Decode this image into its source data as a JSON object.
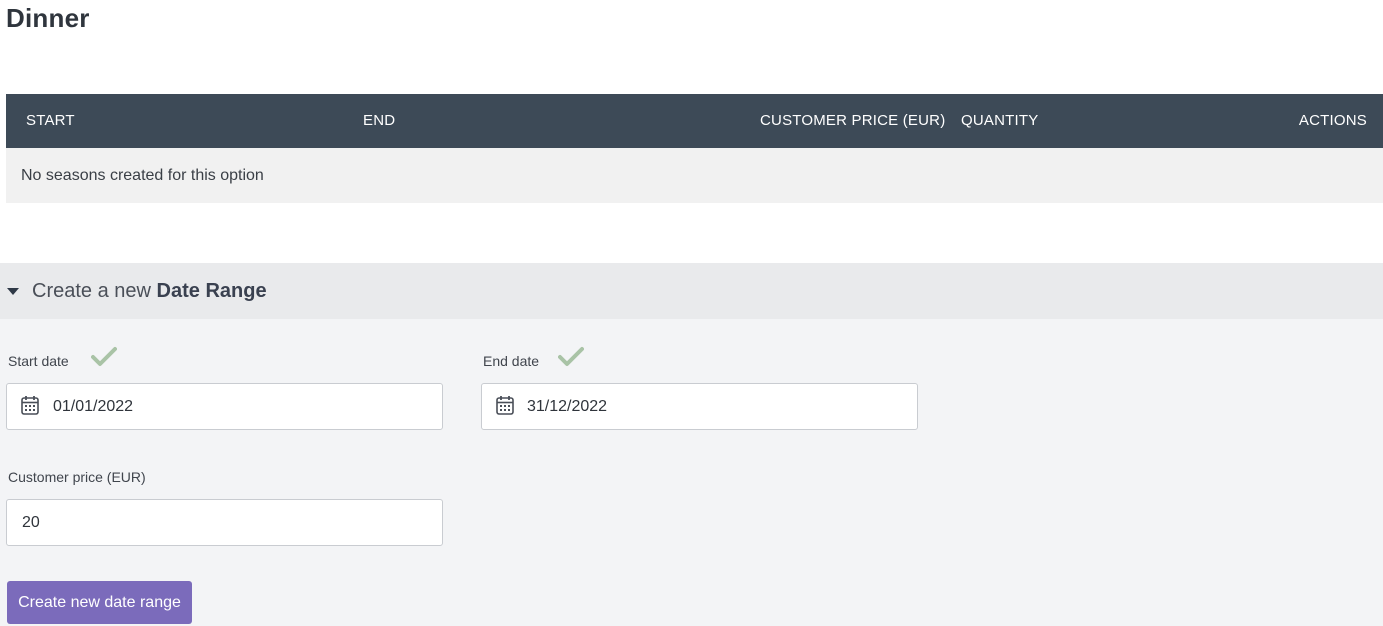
{
  "page": {
    "title": "Dinner"
  },
  "seasons_table": {
    "columns": {
      "start": "START",
      "end": "END",
      "customer_price": "CUSTOMER PRICE (EUR)",
      "quantity": "QUANTITY",
      "actions": "ACTIONS"
    },
    "empty_message": "No seasons created for this option"
  },
  "create_panel": {
    "header_prefix": "Create a new",
    "header_bold": "Date Range",
    "start_date": {
      "label": "Start date",
      "value": "01/01/2022",
      "valid": true
    },
    "end_date": {
      "label": "End date",
      "value": "31/12/2022",
      "valid": true
    },
    "customer_price": {
      "label": "Customer price (EUR)",
      "value": "20"
    },
    "submit_label": "Create new date range"
  },
  "colors": {
    "table_header_bg": "#3d4a57",
    "button_bg": "#7b6bbb",
    "check_color": "#a9c3a6"
  }
}
